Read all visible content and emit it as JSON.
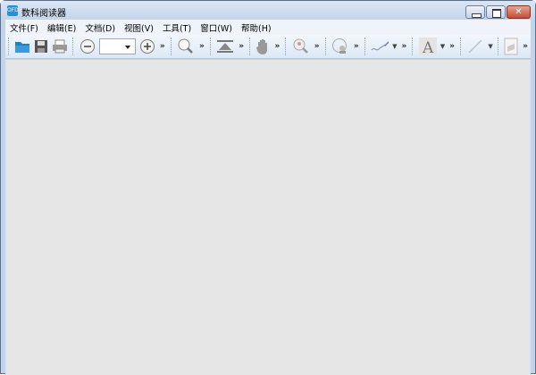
{
  "window": {
    "title": "数科阅读器",
    "app_icon": "ofd-reader-icon",
    "close_glyph": "✕"
  },
  "menu": [
    "文件(F)",
    "编辑(E)",
    "文档(D)",
    "视图(V)",
    "工具(T)",
    "窗口(W)",
    "帮助(H)"
  ],
  "toolbar": {
    "zoom_value": "",
    "more_glyph": "»"
  },
  "colors": {
    "titlebar": "#c4d5ea",
    "content": "#e6e6e6",
    "close": "#c94b33"
  }
}
